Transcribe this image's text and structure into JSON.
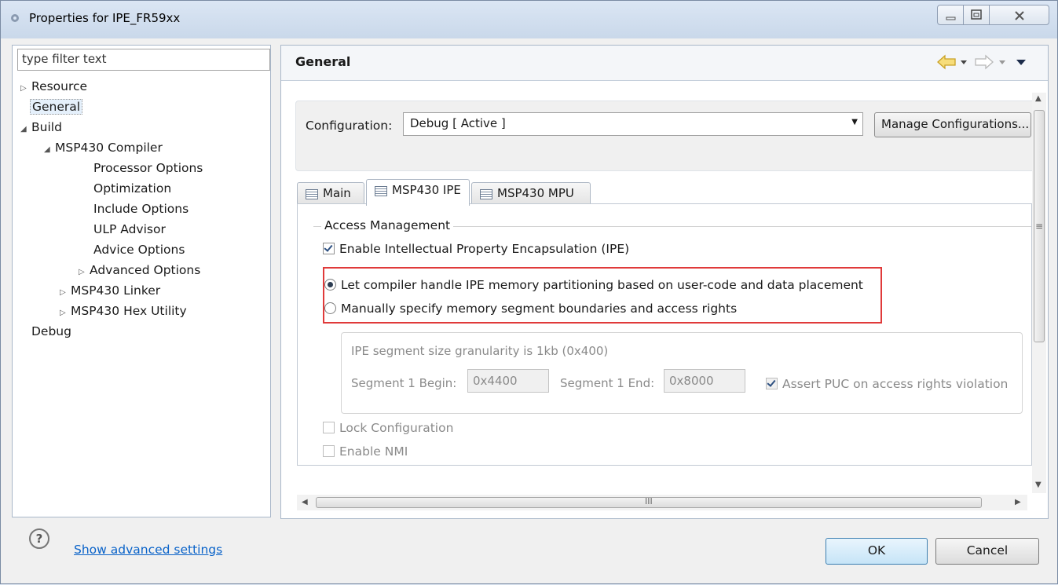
{
  "window": {
    "title": "Properties for IPE_FR59xx"
  },
  "filter": {
    "value": "type filter text"
  },
  "tree": [
    {
      "label": "Resource",
      "arrow": "▷"
    },
    {
      "label": "General",
      "arrow": ""
    },
    {
      "label": "Build",
      "arrow": "◢"
    },
    {
      "label": "MSP430 Compiler",
      "arrow": "◢"
    },
    {
      "label": "Processor Options",
      "arrow": ""
    },
    {
      "label": "Optimization",
      "arrow": ""
    },
    {
      "label": "Include Options",
      "arrow": ""
    },
    {
      "label": "ULP Advisor",
      "arrow": ""
    },
    {
      "label": "Advice Options",
      "arrow": ""
    },
    {
      "label": "Advanced Options",
      "arrow": "▷"
    },
    {
      "label": "MSP430 Linker",
      "arrow": "▷"
    },
    {
      "label": "MSP430 Hex Utility",
      "arrow": "▷"
    },
    {
      "label": "Debug",
      "arrow": ""
    }
  ],
  "page": {
    "title": "General"
  },
  "config": {
    "label": "Configuration:",
    "value": "Debug  [ Active ]",
    "manage_label": "Manage Configurations..."
  },
  "tabs": [
    {
      "label": "Main"
    },
    {
      "label": "MSP430 IPE"
    },
    {
      "label": "MSP430 MPU"
    }
  ],
  "ipe": {
    "group_label": "Access Management",
    "enable_label": "Enable Intellectual Property Encapsulation (IPE)",
    "radio_auto": "Let compiler handle IPE memory partitioning based on user-code and data placement",
    "radio_manual": "Manually specify memory segment boundaries and access rights",
    "granularity": "IPE segment size granularity is 1kb (0x400)",
    "seg_begin_label": "Segment 1 Begin:",
    "seg_begin_value": "0x4400",
    "seg_end_label": "Segment 1 End:",
    "seg_end_value": "0x8000",
    "assert_label": "Assert PUC on access rights violation",
    "lock_label": "Lock Configuration",
    "nmi_label": "Enable NMI"
  },
  "scroll": {
    "hthumb_label": "III",
    "vthumb_label": "≡"
  },
  "footer": {
    "help": "?",
    "advanced_link": "Show advanced settings",
    "ok": "OK",
    "cancel": "Cancel"
  },
  "colors": {
    "highlight_box": "#e03a3a",
    "link": "#0a63c9"
  }
}
